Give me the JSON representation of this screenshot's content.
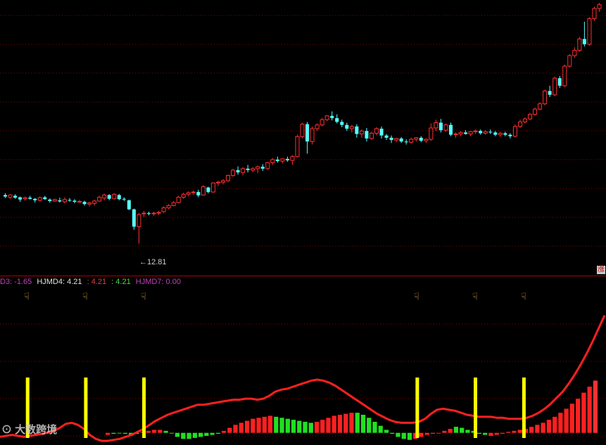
{
  "chart_data": [
    {
      "type": "candlestick",
      "title": "",
      "grid": true,
      "ylim": [
        12.0,
        19.2
      ],
      "low_marker": "12.81",
      "badge": "涨",
      "candles": [
        [
          14.1,
          14.15,
          14.02,
          14.06
        ],
        [
          14.04,
          14.12,
          14.0,
          14.1
        ],
        [
          14.08,
          14.12,
          14.0,
          14.03
        ],
        [
          14.04,
          14.06,
          13.92,
          13.98
        ],
        [
          14.0,
          14.06,
          13.95,
          14.03
        ],
        [
          14.03,
          14.08,
          13.98,
          14.0
        ],
        [
          14.0,
          14.02,
          13.9,
          13.96
        ],
        [
          13.96,
          14.06,
          13.92,
          14.03
        ],
        [
          14.04,
          14.08,
          13.97,
          13.99
        ],
        [
          13.98,
          14.01,
          13.9,
          13.94
        ],
        [
          13.94,
          14.0,
          13.92,
          13.98
        ],
        [
          13.96,
          14.03,
          13.9,
          13.93
        ],
        [
          13.92,
          14.04,
          13.88,
          13.98
        ],
        [
          13.97,
          14.02,
          13.92,
          13.95
        ],
        [
          13.95,
          13.99,
          13.88,
          13.92
        ],
        [
          13.92,
          13.97,
          13.9,
          13.93
        ],
        [
          13.92,
          13.95,
          13.82,
          13.86
        ],
        [
          13.86,
          13.92,
          13.8,
          13.89
        ],
        [
          13.88,
          13.98,
          13.82,
          13.94
        ],
        [
          13.94,
          14.08,
          13.92,
          14.04
        ],
        [
          14.02,
          14.14,
          13.96,
          14.1
        ],
        [
          14.1,
          14.12,
          13.96,
          14.0
        ],
        [
          14.0,
          14.15,
          13.98,
          14.12
        ],
        [
          14.1,
          14.13,
          13.96,
          13.99
        ],
        [
          14.0,
          14.04,
          13.94,
          13.98
        ],
        [
          13.96,
          13.98,
          13.7,
          13.72
        ],
        [
          13.72,
          13.74,
          13.18,
          13.26
        ],
        [
          13.26,
          13.62,
          12.81,
          13.58
        ],
        [
          13.6,
          13.68,
          13.52,
          13.62
        ],
        [
          13.62,
          13.66,
          13.56,
          13.6
        ],
        [
          13.6,
          13.66,
          13.55,
          13.62
        ],
        [
          13.62,
          13.68,
          13.57,
          13.64
        ],
        [
          13.66,
          13.8,
          13.62,
          13.76
        ],
        [
          13.76,
          13.86,
          13.72,
          13.82
        ],
        [
          13.82,
          13.94,
          13.8,
          13.9
        ],
        [
          13.9,
          14.08,
          13.88,
          14.04
        ],
        [
          14.04,
          14.16,
          14.0,
          14.12
        ],
        [
          14.12,
          14.2,
          14.06,
          14.16
        ],
        [
          14.16,
          14.22,
          14.1,
          14.18
        ],
        [
          14.18,
          14.24,
          14.04,
          14.09
        ],
        [
          14.1,
          14.36,
          14.08,
          14.32
        ],
        [
          14.3,
          14.32,
          14.14,
          14.18
        ],
        [
          14.18,
          14.44,
          14.16,
          14.42
        ],
        [
          14.42,
          14.48,
          14.34,
          14.44
        ],
        [
          14.44,
          14.52,
          14.38,
          14.48
        ],
        [
          14.48,
          14.64,
          14.44,
          14.62
        ],
        [
          14.62,
          14.8,
          14.58,
          14.76
        ],
        [
          14.76,
          14.86,
          14.64,
          14.7
        ],
        [
          14.7,
          14.84,
          14.62,
          14.8
        ],
        [
          14.8,
          14.9,
          14.7,
          14.76
        ],
        [
          14.76,
          14.84,
          14.7,
          14.8
        ],
        [
          14.8,
          14.88,
          14.68,
          14.85
        ],
        [
          14.85,
          14.92,
          14.74,
          14.8
        ],
        [
          14.8,
          14.98,
          14.76,
          14.96
        ],
        [
          14.96,
          15.08,
          14.9,
          15.04
        ],
        [
          15.04,
          15.12,
          14.96,
          15.0
        ],
        [
          15.0,
          15.08,
          14.94,
          15.06
        ],
        [
          15.06,
          15.12,
          14.98,
          15.02
        ],
        [
          15.02,
          15.16,
          14.9,
          15.12
        ],
        [
          15.12,
          15.7,
          15.1,
          15.65
        ],
        [
          15.65,
          16.02,
          15.6,
          15.98
        ],
        [
          15.98,
          16.04,
          15.2,
          15.52
        ],
        [
          15.52,
          15.92,
          15.44,
          15.86
        ],
        [
          15.86,
          16.0,
          15.8,
          15.96
        ],
        [
          15.96,
          16.15,
          15.92,
          16.1
        ],
        [
          16.1,
          16.22,
          16.06,
          16.2
        ],
        [
          16.2,
          16.32,
          16.08,
          16.14
        ],
        [
          16.14,
          16.24,
          16.0,
          16.04
        ],
        [
          16.04,
          16.1,
          15.9,
          15.96
        ],
        [
          15.96,
          16.02,
          15.8,
          15.86
        ],
        [
          15.86,
          15.96,
          15.76,
          15.92
        ],
        [
          15.92,
          15.98,
          15.62,
          15.72
        ],
        [
          15.72,
          15.84,
          15.62,
          15.8
        ],
        [
          15.8,
          15.88,
          15.52,
          15.6
        ],
        [
          15.6,
          15.78,
          15.56,
          15.74
        ],
        [
          15.74,
          15.9,
          15.68,
          15.86
        ],
        [
          15.86,
          15.92,
          15.6,
          15.68
        ],
        [
          15.68,
          15.72,
          15.56,
          15.62
        ],
        [
          15.62,
          15.68,
          15.48,
          15.56
        ],
        [
          15.56,
          15.62,
          15.5,
          15.6
        ],
        [
          15.6,
          15.64,
          15.48,
          15.52
        ],
        [
          15.52,
          15.58,
          15.44,
          15.5
        ],
        [
          15.5,
          15.62,
          15.46,
          15.58
        ],
        [
          15.58,
          15.64,
          15.52,
          15.62
        ],
        [
          15.62,
          15.66,
          15.5,
          15.54
        ],
        [
          15.54,
          15.6,
          15.48,
          15.58
        ],
        [
          15.58,
          16.0,
          15.54,
          15.88
        ],
        [
          15.88,
          16.1,
          15.8,
          16.02
        ],
        [
          16.02,
          16.12,
          15.76,
          15.82
        ],
        [
          15.82,
          16.0,
          15.78,
          15.96
        ],
        [
          15.96,
          16.02,
          15.66,
          15.7
        ],
        [
          15.7,
          15.76,
          15.62,
          15.72
        ],
        [
          15.72,
          15.8,
          15.66,
          15.76
        ],
        [
          15.76,
          15.82,
          15.7,
          15.72
        ],
        [
          15.72,
          15.8,
          15.66,
          15.78
        ],
        [
          15.78,
          15.84,
          15.72,
          15.8
        ],
        [
          15.8,
          15.84,
          15.7,
          15.74
        ],
        [
          15.74,
          15.82,
          15.7,
          15.78
        ],
        [
          15.78,
          15.84,
          15.72,
          15.76
        ],
        [
          15.76,
          15.8,
          15.66,
          15.7
        ],
        [
          15.7,
          15.78,
          15.64,
          15.74
        ],
        [
          15.74,
          15.78,
          15.66,
          15.7
        ],
        [
          15.7,
          15.74,
          15.6,
          15.66
        ],
        [
          15.66,
          15.98,
          15.62,
          15.92
        ],
        [
          15.92,
          16.1,
          15.88,
          16.04
        ],
        [
          16.04,
          16.16,
          16.0,
          16.12
        ],
        [
          16.12,
          16.28,
          16.08,
          16.24
        ],
        [
          16.24,
          16.42,
          16.2,
          16.38
        ],
        [
          16.38,
          16.56,
          16.34,
          16.52
        ],
        [
          16.52,
          16.9,
          16.48,
          16.86
        ],
        [
          16.86,
          17.0,
          16.7,
          16.76
        ],
        [
          16.76,
          17.24,
          16.72,
          17.2
        ],
        [
          17.2,
          17.26,
          16.94,
          17.0
        ],
        [
          17.0,
          17.56,
          16.96,
          17.52
        ],
        [
          17.52,
          17.84,
          17.48,
          17.8
        ],
        [
          17.8,
          18.02,
          17.74,
          17.94
        ],
        [
          17.94,
          18.3,
          17.9,
          18.24
        ],
        [
          18.24,
          18.7,
          18.04,
          18.1
        ],
        [
          18.1,
          18.82,
          18.06,
          18.78
        ],
        [
          18.78,
          19.1,
          18.72,
          19.05
        ],
        [
          19.05,
          19.2,
          18.96,
          19.15
        ]
      ]
    },
    {
      "type": "indicator",
      "labels": [
        {
          "text": "D3: -1.65",
          "color": "#c040c0"
        },
        {
          "text": "HJMD4: 4.21",
          "color": "#e0e0e0"
        },
        {
          "text": ": 4.21",
          "color": "#e04040"
        },
        {
          "text": ": 4.21",
          "color": "#40e040"
        },
        {
          "text": "HJMD7: 0.00",
          "color": "#c040c0"
        }
      ],
      "signals": [
        0.045,
        0.141,
        0.237,
        0.688,
        0.784,
        0.864
      ],
      "ylim": [
        -1.0,
        13.0
      ],
      "line": [
        -0.4,
        -0.3,
        -0.2,
        -0.3,
        -0.4,
        -0.3,
        -0.2,
        -0.1,
        0.0,
        0.2,
        0.5,
        0.9,
        1.0,
        0.8,
        0.4,
        -0.2,
        -0.6,
        -0.8,
        -0.8,
        -0.7,
        -0.6,
        -0.4,
        -0.2,
        0.1,
        0.4,
        0.8,
        1.2,
        1.5,
        1.8,
        2.0,
        2.2,
        2.4,
        2.6,
        2.8,
        2.8,
        2.9,
        3.0,
        3.1,
        3.2,
        3.3,
        3.3,
        3.4,
        3.4,
        3.3,
        3.4,
        3.7,
        4.1,
        4.3,
        4.4,
        4.6,
        4.8,
        5.0,
        5.2,
        5.3,
        5.2,
        5.0,
        4.7,
        4.3,
        3.9,
        3.5,
        3.1,
        2.7,
        2.3,
        1.9,
        1.6,
        1.3,
        1.1,
        1.0,
        1.0,
        1.0,
        1.1,
        1.4,
        1.9,
        2.3,
        2.4,
        2.3,
        2.2,
        2.0,
        1.8,
        1.7,
        1.6,
        1.6,
        1.6,
        1.5,
        1.5,
        1.4,
        1.4,
        1.4,
        1.5,
        1.7,
        2.0,
        2.4,
        2.9,
        3.5,
        4.1,
        4.9,
        5.8,
        6.8,
        7.9,
        9.1,
        10.4,
        11.7
      ],
      "bars": [
        -0.2,
        -0.1,
        0.0,
        -0.1,
        -0.2,
        -0.1,
        0.1,
        0.2,
        0.3,
        0.3,
        0.2,
        0.0,
        -0.4,
        -0.6,
        -0.6,
        -0.5,
        -0.4,
        -0.3,
        -0.2,
        -0.1,
        0.2,
        0.5,
        0.8,
        1.0,
        1.2,
        1.4,
        1.5,
        1.6,
        1.7,
        1.6,
        1.5,
        1.4,
        1.3,
        1.2,
        1.1,
        1.0,
        1.1,
        1.3,
        1.5,
        1.7,
        1.8,
        1.9,
        2.0,
        2.0,
        1.8,
        1.5,
        1.1,
        0.7,
        0.3,
        -0.1,
        -0.4,
        -0.6,
        -0.7,
        -0.6,
        -0.4,
        -0.2,
        -0.1,
        0.0,
        0.2,
        0.4,
        0.6,
        0.5,
        0.3,
        0.2,
        -0.1,
        -0.2,
        -0.3,
        -0.2,
        -0.1,
        0.1,
        0.2,
        0.3,
        0.4,
        0.6,
        0.8,
        1.0,
        1.3,
        1.6,
        2.0,
        2.4,
        2.9,
        3.4,
        4.0,
        4.6,
        5.2
      ],
      "bar_colors": [
        "#ff2020",
        "#20e020",
        "#20e020",
        "#20e020",
        "#20e020",
        "#20e020",
        "#ff2020",
        "#ff2020",
        "#ff2020",
        "#ff2020",
        "#20e020",
        "#20e020",
        "#20e020",
        "#20e020",
        "#20e020",
        "#20e020",
        "#20e020",
        "#20e020",
        "#20e020",
        "#20e020",
        "#ff2020",
        "#ff2020",
        "#ff2020",
        "#ff2020",
        "#ff2020",
        "#ff2020",
        "#ff2020",
        "#ff2020",
        "#ff2020",
        "#20e020",
        "#20e020",
        "#20e020",
        "#20e020",
        "#20e020",
        "#20e020",
        "#20e020",
        "#ff2020",
        "#ff2020",
        "#ff2020",
        "#ff2020",
        "#ff2020",
        "#ff2020",
        "#ff2020",
        "#20e020",
        "#20e020",
        "#20e020",
        "#20e020",
        "#20e020",
        "#20e020",
        "#20e020",
        "#20e020",
        "#20e020",
        "#20e020",
        "#ff2020",
        "#ff2020",
        "#ff2020",
        "#ff2020",
        "#ff2020",
        "#ff2020",
        "#ff2020",
        "#20e020",
        "#20e020",
        "#20e020",
        "#20e020",
        "#20e020",
        "#20e020",
        "#ff2020",
        "#ff2020",
        "#ff2020",
        "#ff2020",
        "#ff2020",
        "#ff2020",
        "#ff2020",
        "#ff2020",
        "#ff2020",
        "#ff2020",
        "#ff2020",
        "#ff2020",
        "#ff2020",
        "#ff2020",
        "#ff2020",
        "#ff2020",
        "#ff2020",
        "#ff2020"
      ]
    }
  ],
  "watermark": "大数跨境",
  "colors": {
    "up": "#ff3030",
    "down": "#54ffff",
    "grid": "#8b0000",
    "line": "#ff2020",
    "signal": "#ffff00",
    "background": "#000000"
  }
}
